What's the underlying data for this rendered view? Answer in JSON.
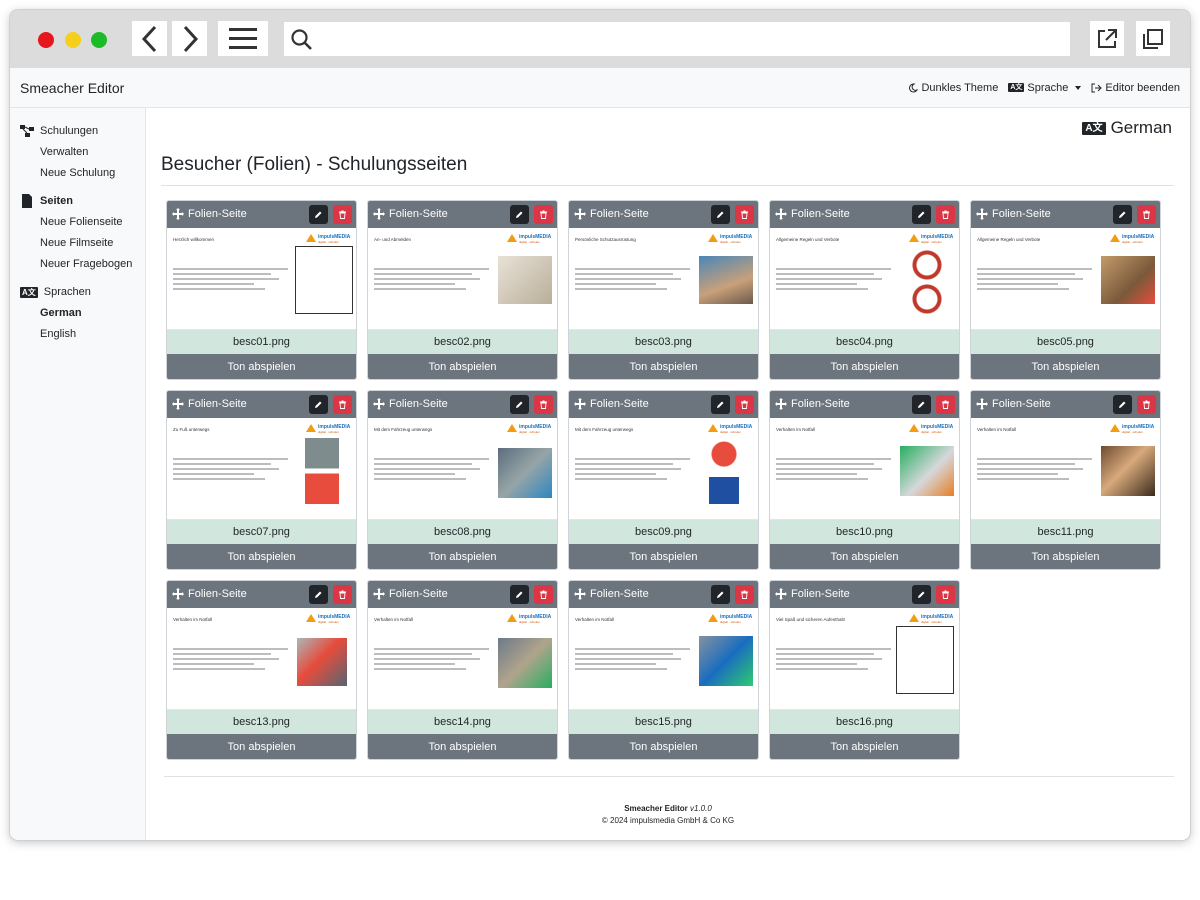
{
  "browser": {
    "colors": {
      "close": "#e6161c",
      "minimize": "#f5cf1c",
      "maximize": "#1cbc28"
    },
    "icons": [
      "back-icon",
      "forward-icon",
      "menu-icon",
      "search-icon",
      "external-link-icon",
      "duplicate-window-icon"
    ]
  },
  "topbar": {
    "brand": "Smeacher Editor",
    "dark_theme": "Dunkles Theme",
    "language": "Sprache",
    "exit": "Editor beenden"
  },
  "sidebar": {
    "sections": [
      {
        "label": "Schulungen",
        "icon": "diagram-icon",
        "items": [
          "Verwalten",
          "Neue Schulung"
        ]
      },
      {
        "label": "Seiten",
        "icon": "file-icon",
        "items": [
          "Neue Folienseite",
          "Neue Filmseite",
          "Neuer Fragebogen"
        ]
      },
      {
        "label": "Sprachen",
        "icon": "translate-icon",
        "items": [
          "German",
          "English"
        ]
      }
    ],
    "active_section": "Seiten",
    "active_language": "German"
  },
  "main": {
    "current_language": "German",
    "title": "Besucher (Folien) - Schulungsseiten",
    "card_type_label": "Folien-Seite",
    "play_label": "Ton abspielen",
    "cards": [
      {
        "file": "besc01.png",
        "heading": "Herzlich willkommen"
      },
      {
        "file": "besc02.png",
        "heading": "An- und Abmelden"
      },
      {
        "file": "besc03.png",
        "heading": "Persönliche Schutzausrüstung"
      },
      {
        "file": "besc04.png",
        "heading": "Allgemeine Regeln und Verbote"
      },
      {
        "file": "besc05.png",
        "heading": "Allgemeine Regeln und Verbote"
      },
      {
        "file": "besc07.png",
        "heading": "Zu Fuß unterwegs"
      },
      {
        "file": "besc08.png",
        "heading": "Mit dem Fahrzeug unterwegs"
      },
      {
        "file": "besc09.png",
        "heading": "Mit dem Fahrzeug unterwegs"
      },
      {
        "file": "besc10.png",
        "heading": "Verhalten im Notfall"
      },
      {
        "file": "besc11.png",
        "heading": "Verhalten im Notfall"
      },
      {
        "file": "besc13.png",
        "heading": "Verhalten im Notfall"
      },
      {
        "file": "besc14.png",
        "heading": "Verhalten im Notfall"
      },
      {
        "file": "besc15.png",
        "heading": "Verhalten im Notfall"
      },
      {
        "file": "besc16.png",
        "heading": "Viel Spaß und sicheren Aufenthalt!"
      }
    ]
  },
  "footer": {
    "app": "Smeacher Editor",
    "version": "v1.0.0",
    "copyright": "© 2024 impulsmedia GmbH & Co KG"
  },
  "colors": {
    "card_header": "#6c757d",
    "filename_bg": "#d1e7dd",
    "delete": "#dc3545",
    "edit": "#212529"
  }
}
